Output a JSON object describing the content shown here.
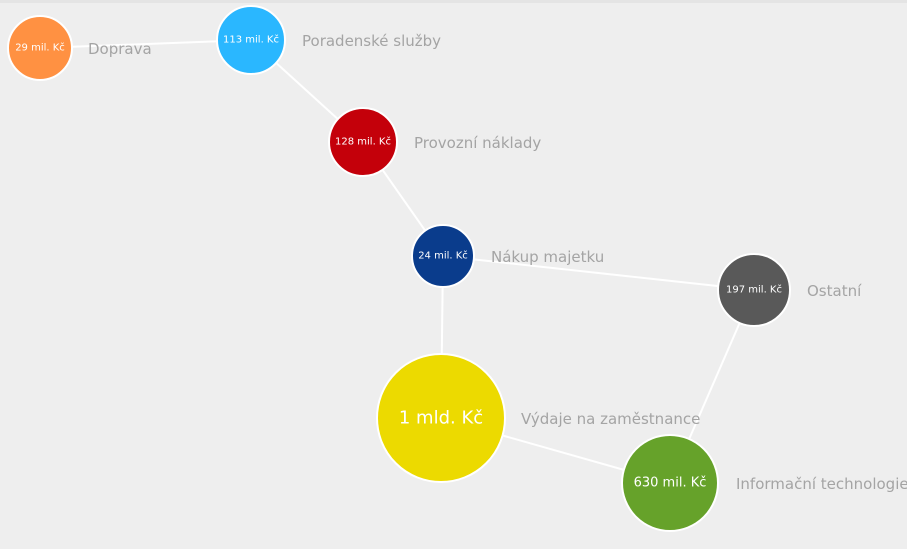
{
  "nodes": [
    {
      "id": "doprava",
      "value": "29 mil. Kč",
      "label": "Doprava",
      "color": "#ff9142"
    },
    {
      "id": "poradenske",
      "value": "113 mil. Kč",
      "label": "Poradenské služby",
      "color": "#2ab7ff"
    },
    {
      "id": "provozni",
      "value": "128 mil. Kč",
      "label": "Provozní náklady",
      "color": "#c4000a"
    },
    {
      "id": "nakup",
      "value": "24 mil. Kč",
      "label": "Nákup majetku",
      "color": "#0a3c8c"
    },
    {
      "id": "ostatni",
      "value": "197 mil. Kč",
      "label": "Ostatní",
      "color": "#595959"
    },
    {
      "id": "zamestnance",
      "value": "1 mld. Kč",
      "label": "Výdaje na zaměstnance",
      "color": "#ecda00"
    },
    {
      "id": "it",
      "value": "630 mil. Kč",
      "label": "Informační technologie",
      "color": "#66a22a"
    }
  ],
  "edges": [
    [
      "doprava",
      "poradenske"
    ],
    [
      "poradenske",
      "provozni"
    ],
    [
      "provozni",
      "nakup"
    ],
    [
      "nakup",
      "ostatni"
    ],
    [
      "nakup",
      "zamestnance"
    ],
    [
      "zamestnance",
      "it"
    ],
    [
      "ostatni",
      "it"
    ]
  ]
}
